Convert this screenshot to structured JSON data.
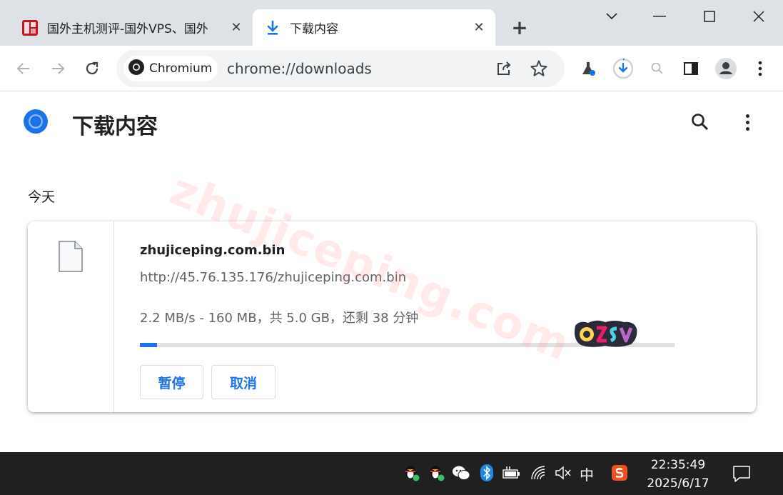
{
  "tabs": [
    {
      "title": "国外主机测评-国外VPS、国外",
      "active": false,
      "favicon": "site-seal-icon"
    },
    {
      "title": "下载内容",
      "active": true,
      "favicon": "download-icon"
    }
  ],
  "toolbar": {
    "chip_label": "Chromium",
    "url": "chrome://downloads"
  },
  "page": {
    "title": "下载内容",
    "date_header": "今天"
  },
  "download": {
    "file_name": "zhujiceping.com.bin",
    "url": "http://45.76.135.176/zhujiceping.com.bin",
    "status": "2.2 MB/s - 160 MB，共 5.0 GB，还剩 38 分钟",
    "progress_fraction": 0.032,
    "pause_label": "暂停",
    "cancel_label": "取消"
  },
  "watermark": {
    "text": "zhujiceping.com",
    "sticker_text": "OZSV"
  },
  "taskbar": {
    "ime": "中",
    "time": "22:35:49",
    "date": "2025/6/17"
  },
  "colors": {
    "accent": "#1a73e8",
    "tabstrip": "#dee1e6",
    "taskbar": "#202020"
  }
}
